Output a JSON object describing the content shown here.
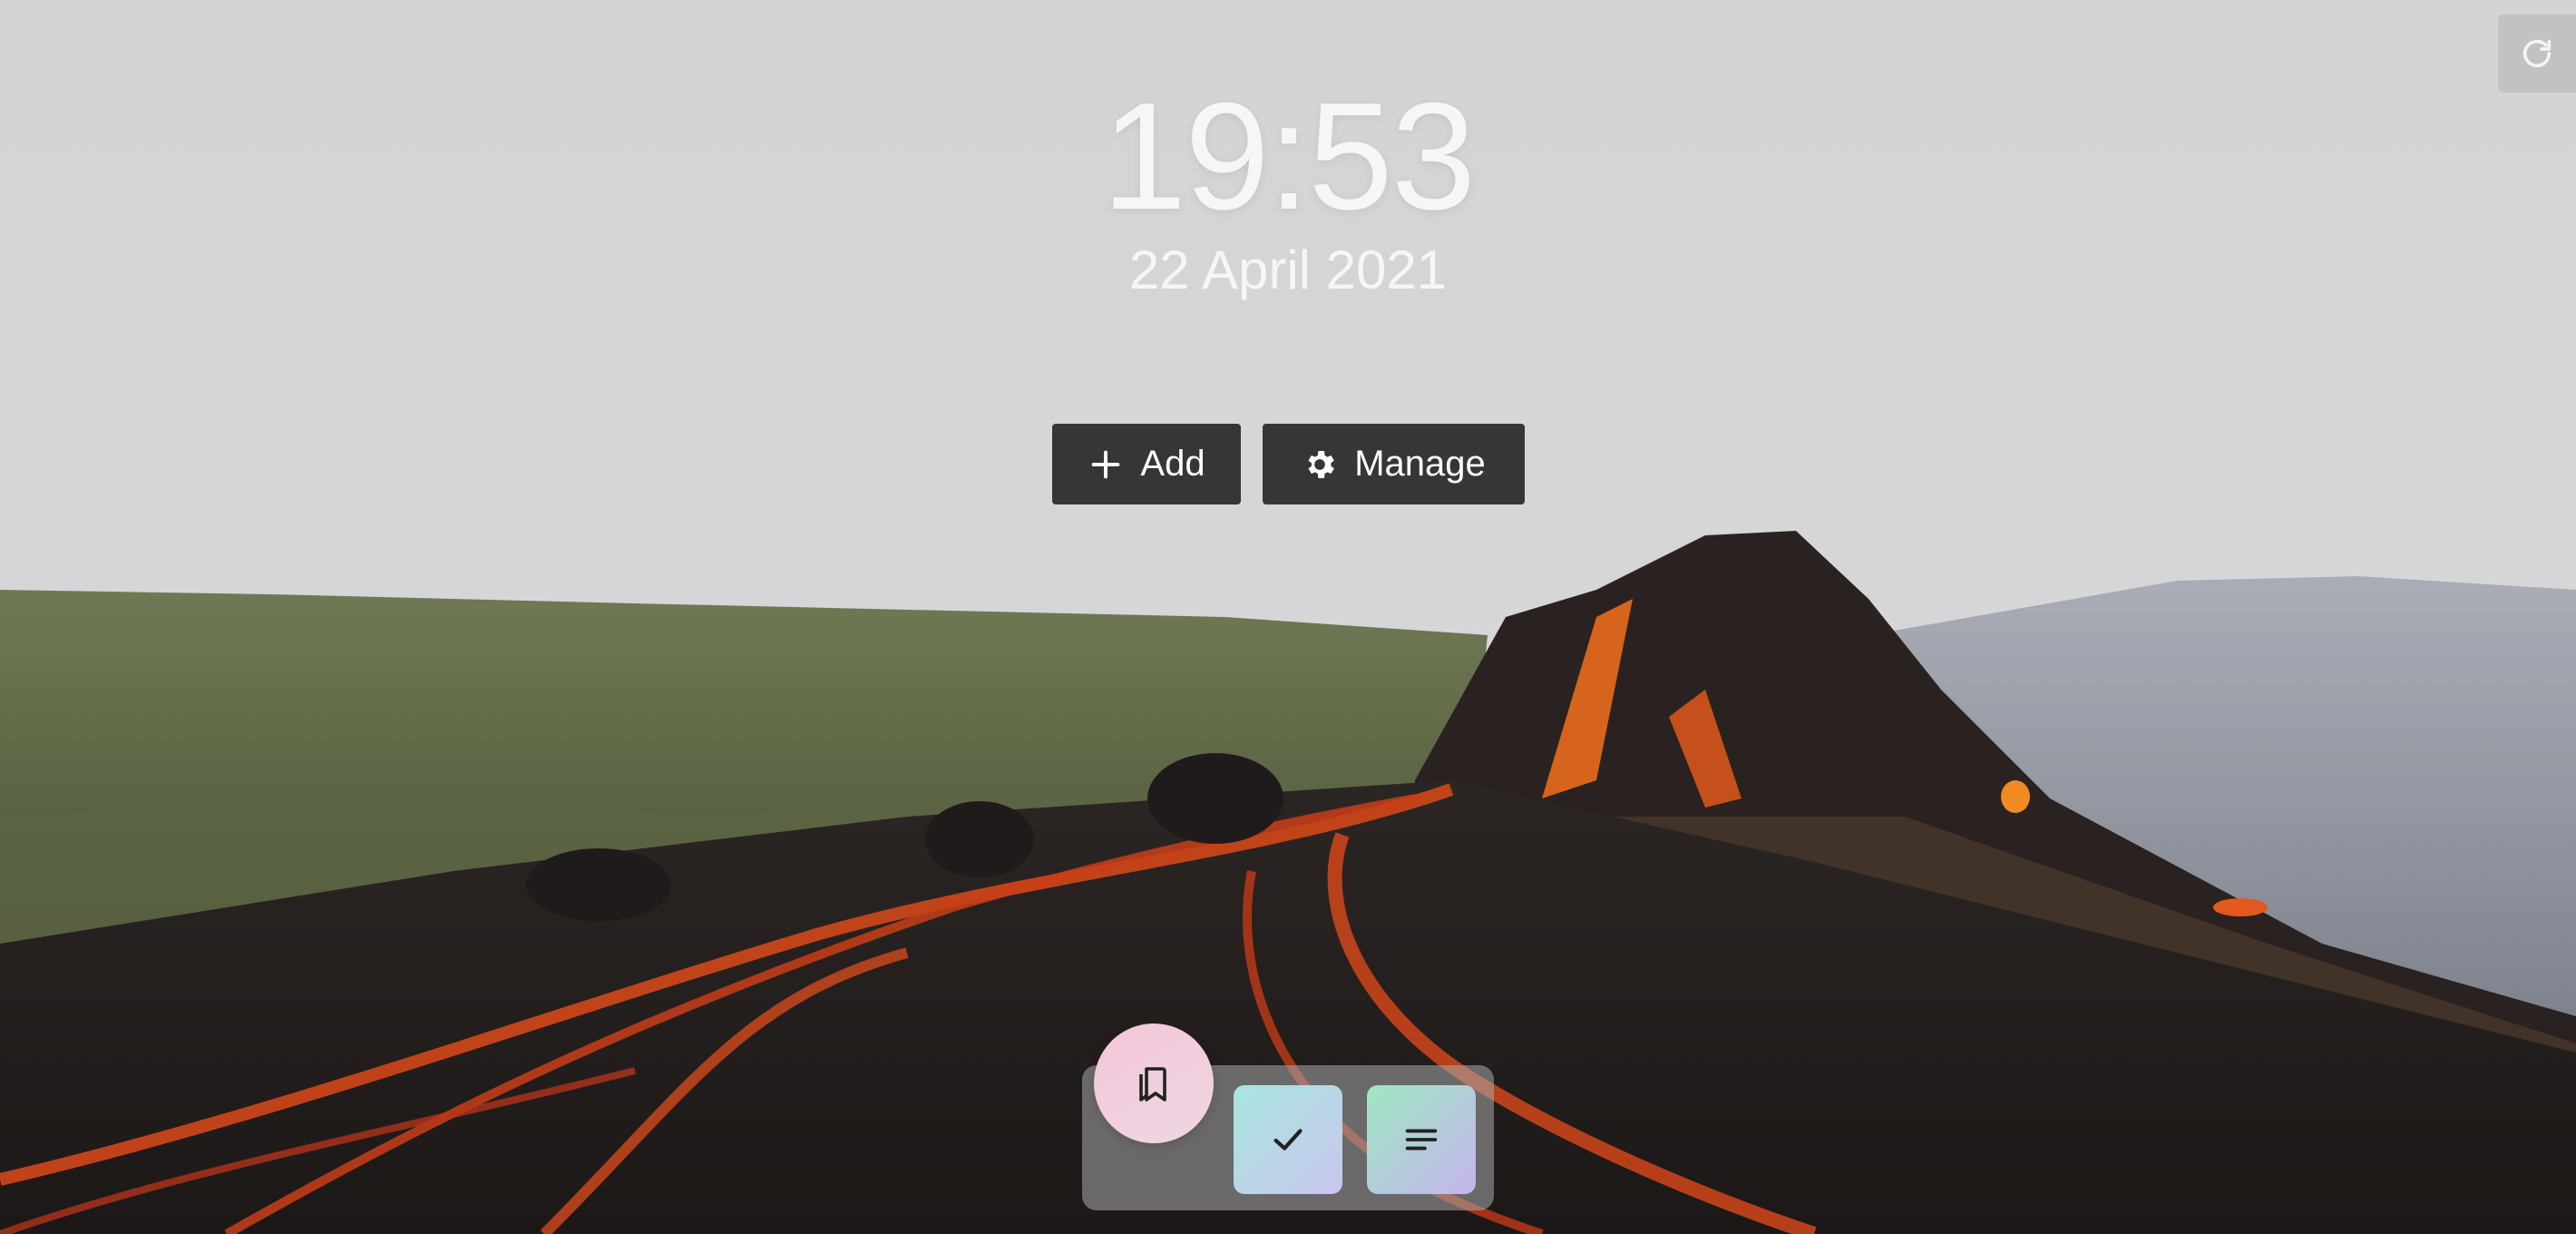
{
  "clock": {
    "time": "19:53",
    "date": "22 April 2021"
  },
  "actions": {
    "add_label": "Add",
    "manage_label": "Manage"
  },
  "icons": {
    "refresh": "refresh-icon",
    "add": "plus-icon",
    "manage": "gear-icon",
    "bookmarks": "bookmarks-icon",
    "tasks": "check-icon",
    "notes": "notes-icon"
  },
  "colors": {
    "button_bg": "#363636",
    "text": "#f6f6f6"
  }
}
